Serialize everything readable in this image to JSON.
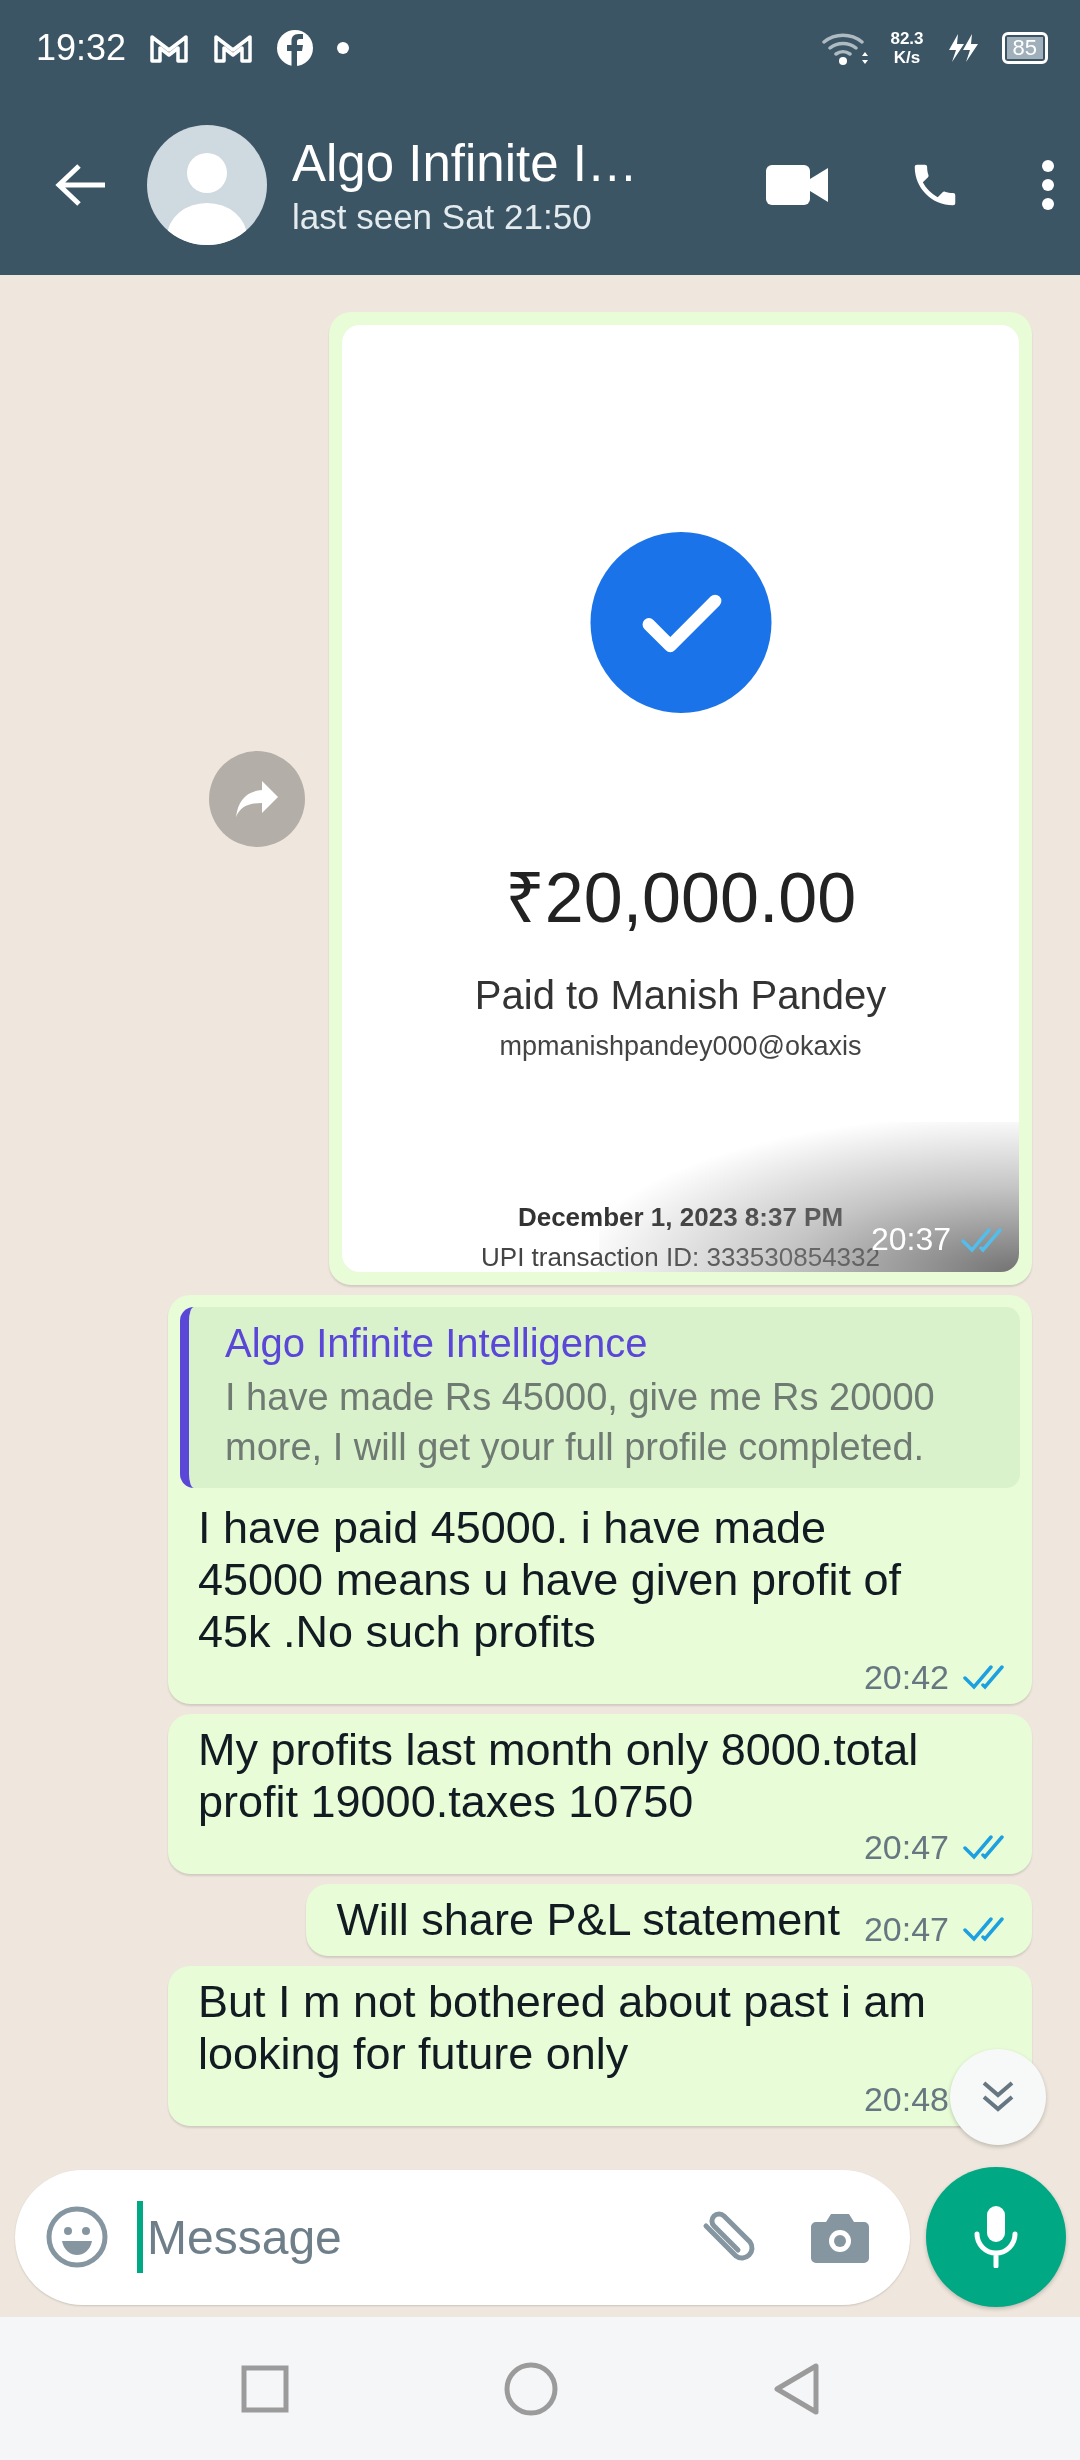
{
  "status_bar": {
    "time": "19:32",
    "speed": "82.3",
    "speed_unit": "K/s",
    "battery": "85"
  },
  "header": {
    "title": "Algo Infinite I…",
    "subtitle": "last seen Sat 21:50"
  },
  "messages": [
    {
      "kind": "image",
      "time": "20:37",
      "read": true,
      "receipt": {
        "amount": "₹20,000.00",
        "payee": "Paid to Manish Pandey",
        "upi_id": "mpmanishpandey000@okaxis",
        "date": "December 1, 2023 8:37 PM",
        "transaction": "UPI transaction ID: 333530854332"
      }
    },
    {
      "kind": "reply",
      "quote": {
        "author": "Algo Infinite Intelligence",
        "text": "I have made Rs 45000, give me Rs 20000 more, I will get your full profile completed."
      },
      "text": "I have paid 45000. i have made 45000 means u have given profit of 45k .No such profits",
      "time": "20:42",
      "read": true
    },
    {
      "kind": "text",
      "text": "My profits last month only 8000.total profit 19000.taxes 10750",
      "time": "20:47",
      "read": true
    },
    {
      "kind": "text",
      "text": "Will share P&L statement",
      "time": "20:47",
      "read": true
    },
    {
      "kind": "text",
      "text": "But I m not bothered about past i am looking for future only",
      "time": "20:48"
    }
  ],
  "composer": {
    "placeholder": "Message"
  }
}
